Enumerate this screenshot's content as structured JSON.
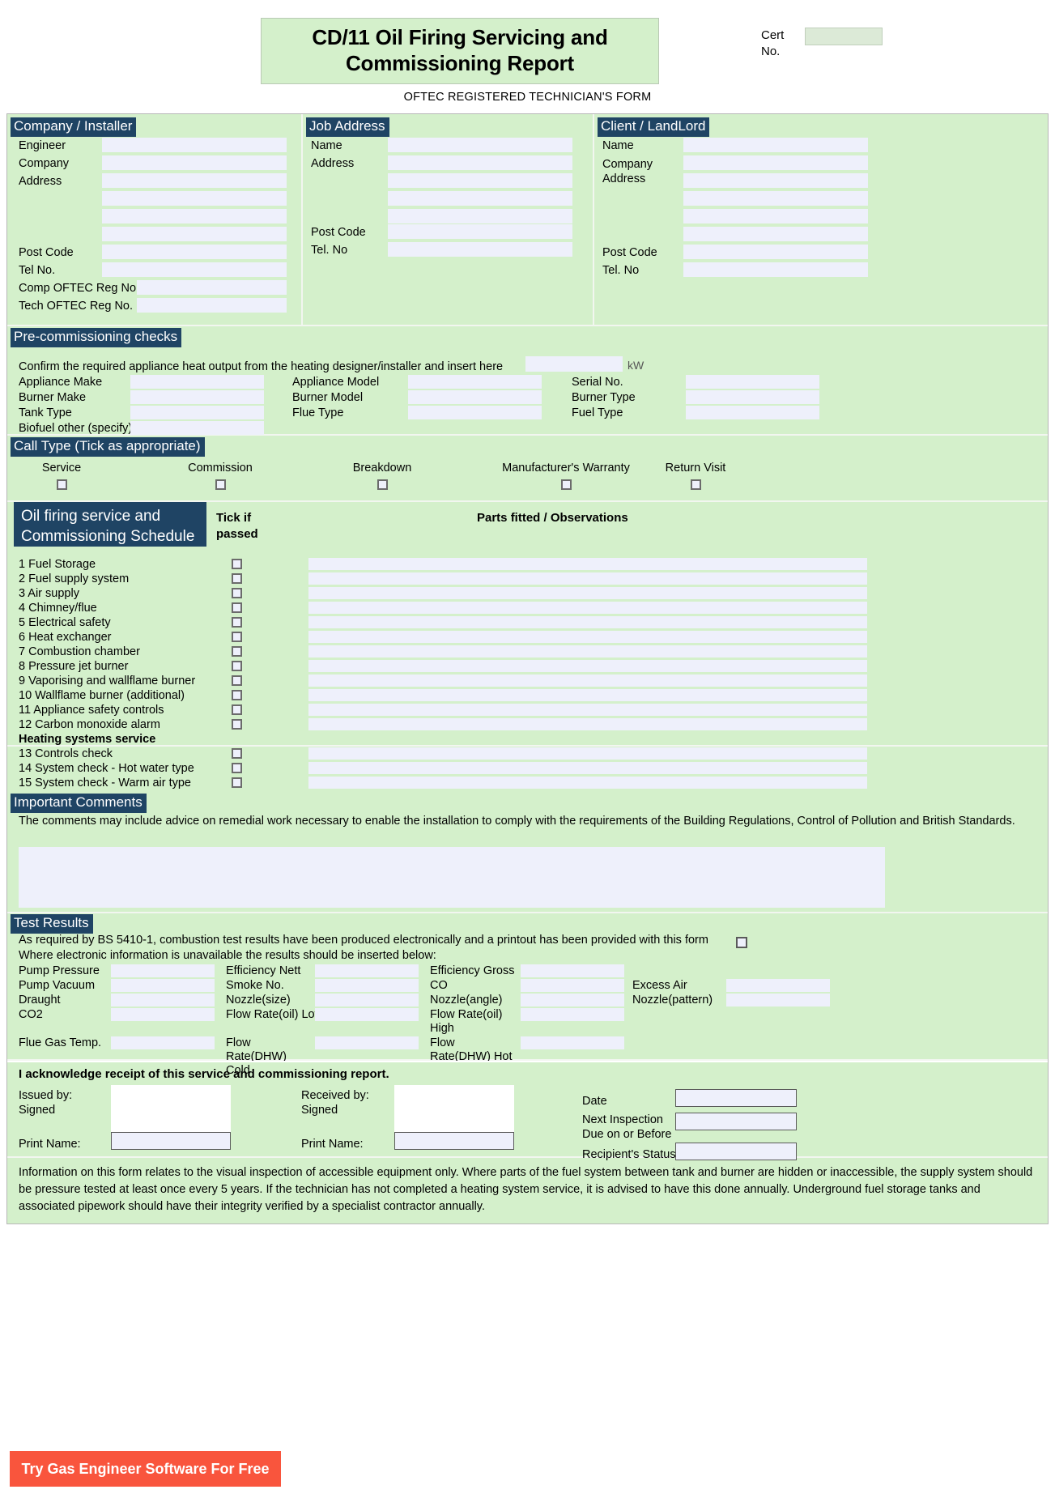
{
  "header": {
    "title": "CD/11 Oil Firing Servicing and Commissioning Report",
    "cert_label": "Cert No.",
    "cert_value": "",
    "subtitle": "OFTEC REGISTERED TECHNICIAN'S FORM"
  },
  "company": {
    "heading": "Company / Installer",
    "rows": [
      {
        "label": "Engineer",
        "value": ""
      },
      {
        "label": "Company",
        "value": ""
      },
      {
        "label": "Address",
        "value": ""
      },
      {
        "label": "",
        "value": ""
      },
      {
        "label": "",
        "value": ""
      },
      {
        "label": "",
        "value": ""
      },
      {
        "label": "Post Code",
        "value": ""
      },
      {
        "label": "Tel No.",
        "value": ""
      },
      {
        "label": "Comp OFTEC Reg No.",
        "value": ""
      },
      {
        "label": "Tech OFTEC Reg No.",
        "value": ""
      }
    ]
  },
  "job_address": {
    "heading": "Job Address",
    "rows": [
      {
        "label": "Name",
        "value": ""
      },
      {
        "label": "Address",
        "value": ""
      },
      {
        "label": "",
        "value": ""
      },
      {
        "label": "",
        "value": ""
      },
      {
        "label": "",
        "value": ""
      },
      {
        "label": "Post Code",
        "value": ""
      },
      {
        "label": "Tel. No",
        "value": ""
      }
    ]
  },
  "client": {
    "heading": "Client / LandLord",
    "rows": [
      {
        "label": "Name",
        "value": ""
      },
      {
        "label": "Company",
        "value": ""
      },
      {
        "label": "Address",
        "value": ""
      },
      {
        "label": "",
        "value": ""
      },
      {
        "label": "",
        "value": ""
      },
      {
        "label": "",
        "value": ""
      },
      {
        "label": "Post Code",
        "value": ""
      },
      {
        "label": "Tel. No",
        "value": ""
      }
    ]
  },
  "pre_commissioning": {
    "heading": "Pre-commissioning checks",
    "note": "Confirm the required appliance heat output from the heating designer/installer and insert here",
    "kw_value": "",
    "kw_unit": "kW",
    "fields": [
      {
        "label": "Appliance Make",
        "value": ""
      },
      {
        "label": "Appliance Model",
        "value": ""
      },
      {
        "label": "Serial No.",
        "value": ""
      },
      {
        "label": "Burner Make",
        "value": ""
      },
      {
        "label": "Burner Model",
        "value": ""
      },
      {
        "label": "Burner Type",
        "value": ""
      },
      {
        "label": "Tank Type",
        "value": ""
      },
      {
        "label": "Flue Type",
        "value": ""
      },
      {
        "label": "Fuel Type",
        "value": ""
      },
      {
        "label": "Biofuel other (specify)",
        "value": ""
      }
    ]
  },
  "call_type": {
    "heading": "Call Type (Tick as appropriate)",
    "options": [
      {
        "label": "Service",
        "checked": false
      },
      {
        "label": "Commission",
        "checked": false
      },
      {
        "label": "Breakdown",
        "checked": false
      },
      {
        "label": "Manufacturer's Warranty",
        "checked": false
      },
      {
        "label": "Return Visit",
        "checked": false
      }
    ]
  },
  "schedule": {
    "heading": "Oil firing service and Commissioning Schedule",
    "col_tick": "Tick if passed",
    "col_parts": "Parts fitted / Observations",
    "items": [
      {
        "label": "1 Fuel Storage",
        "checked": false,
        "observation": "",
        "is_heading": false
      },
      {
        "label": "2 Fuel supply system",
        "checked": false,
        "observation": "",
        "is_heading": false
      },
      {
        "label": "3 Air supply",
        "checked": false,
        "observation": "",
        "is_heading": false
      },
      {
        "label": "4 Chimney/flue",
        "checked": false,
        "observation": "",
        "is_heading": false
      },
      {
        "label": "5 Electrical safety",
        "checked": false,
        "observation": "",
        "is_heading": false
      },
      {
        "label": "6 Heat exchanger",
        "checked": false,
        "observation": "",
        "is_heading": false
      },
      {
        "label": "7 Combustion chamber",
        "checked": false,
        "observation": "",
        "is_heading": false
      },
      {
        "label": "8 Pressure jet burner",
        "checked": false,
        "observation": "",
        "is_heading": false
      },
      {
        "label": "9 Vaporising and wallflame burner",
        "checked": false,
        "observation": "",
        "is_heading": false
      },
      {
        "label": "10 Wallflame burner (additional)",
        "checked": false,
        "observation": "",
        "is_heading": false
      },
      {
        "label": "11 Appliance safety controls",
        "checked": false,
        "observation": "",
        "is_heading": false
      },
      {
        "label": "12 Carbon monoxide alarm",
        "checked": false,
        "observation": "",
        "is_heading": false
      },
      {
        "label": "Heating systems service",
        "checked": null,
        "observation": null,
        "is_heading": true
      },
      {
        "label": "13 Controls check",
        "checked": false,
        "observation": "",
        "is_heading": false
      },
      {
        "label": "14 System check - Hot water type",
        "checked": false,
        "observation": "",
        "is_heading": false
      },
      {
        "label": "15 System check - Warm air type",
        "checked": false,
        "observation": "",
        "is_heading": false
      }
    ]
  },
  "comments": {
    "heading": "Important Comments",
    "note": "The comments may include advice on remedial work necessary to enable the installation to comply with the requirements of the Building Regulations, Control of Pollution and British Standards.",
    "value": ""
  },
  "test_results": {
    "heading": "Test Results",
    "note_line1": "As required by BS 5410-1, combustion test results have been produced electronically and a printout has been provided with this form",
    "note_line2": "Where electronic information is unavailable the results should be inserted below:",
    "printout_checked": false,
    "col1": [
      {
        "label": "Pump Pressure",
        "value": ""
      },
      {
        "label": "Pump Vacuum",
        "value": ""
      },
      {
        "label": "Draught",
        "value": ""
      },
      {
        "label": "CO2",
        "value": ""
      }
    ],
    "col2": [
      {
        "label": "Efficiency Nett",
        "value": ""
      },
      {
        "label": "Smoke No.",
        "value": ""
      },
      {
        "label": "Nozzle(size)",
        "value": ""
      },
      {
        "label": "Flow Rate(oil) Low",
        "value": ""
      }
    ],
    "col3": [
      {
        "label": "Efficiency Gross",
        "value": ""
      },
      {
        "label": "CO",
        "value": ""
      },
      {
        "label": "Nozzle(angle)",
        "value": ""
      },
      {
        "label": "Flow Rate(oil) High",
        "value": ""
      }
    ],
    "col4": [
      {
        "label": "Excess Air",
        "value": ""
      },
      {
        "label": "Nozzle(pattern)",
        "value": ""
      }
    ],
    "bottom": [
      {
        "label": "Flue Gas Temp.",
        "value": ""
      },
      {
        "label": "Flow Rate(DHW) Cold",
        "value": ""
      },
      {
        "label": "Flow Rate(DHW) Hot",
        "value": ""
      }
    ]
  },
  "acknowledge": {
    "title": "I acknowledge receipt of this service and commissioning report.",
    "issued_label": "Issued by: Signed",
    "issued_signature": "",
    "issued_print_label": "Print Name:",
    "issued_print_value": "",
    "received_label": "Received by: Signed",
    "received_signature": "",
    "received_print_label": "Print Name:",
    "received_print_value": "",
    "date_label": "Date",
    "date_value": "",
    "next_inspection_label": "Next Inspection Due on or Before",
    "next_inspection_value": "",
    "recipient_status_label": "Recipient's Status",
    "recipient_status_value": ""
  },
  "footer_note": "Information on this form relates to the visual inspection of accessible equipment only. Where parts of the fuel system between tank and burner are hidden or inaccessible, the supply system should be pressure tested at least once every 5 years. If the technician has not completed a heating system service, it is advised to have this done annually. Underground fuel storage tanks and associated pipework should have their integrity verified by a specialist contractor annually.",
  "cta": {
    "label": "Try Gas Engineer Software For Free"
  }
}
